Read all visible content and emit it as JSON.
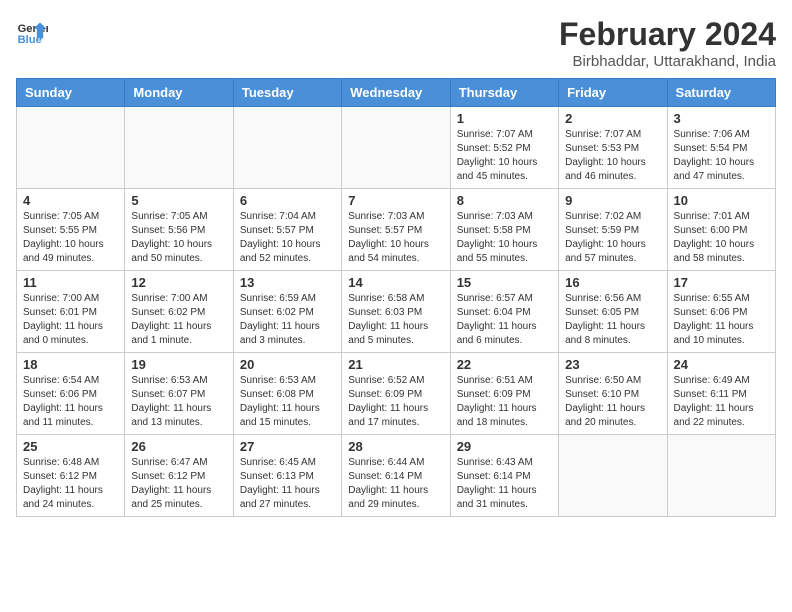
{
  "logo": {
    "text_general": "General",
    "text_blue": "Blue"
  },
  "header": {
    "title": "February 2024",
    "subtitle": "Birbhaddar, Uttarakhand, India"
  },
  "weekdays": [
    "Sunday",
    "Monday",
    "Tuesday",
    "Wednesday",
    "Thursday",
    "Friday",
    "Saturday"
  ],
  "weeks": [
    [
      {
        "day": "",
        "sunrise": "",
        "sunset": "",
        "daylight": ""
      },
      {
        "day": "",
        "sunrise": "",
        "sunset": "",
        "daylight": ""
      },
      {
        "day": "",
        "sunrise": "",
        "sunset": "",
        "daylight": ""
      },
      {
        "day": "",
        "sunrise": "",
        "sunset": "",
        "daylight": ""
      },
      {
        "day": "1",
        "sunrise": "Sunrise: 7:07 AM",
        "sunset": "Sunset: 5:52 PM",
        "daylight": "Daylight: 10 hours and 45 minutes."
      },
      {
        "day": "2",
        "sunrise": "Sunrise: 7:07 AM",
        "sunset": "Sunset: 5:53 PM",
        "daylight": "Daylight: 10 hours and 46 minutes."
      },
      {
        "day": "3",
        "sunrise": "Sunrise: 7:06 AM",
        "sunset": "Sunset: 5:54 PM",
        "daylight": "Daylight: 10 hours and 47 minutes."
      }
    ],
    [
      {
        "day": "4",
        "sunrise": "Sunrise: 7:05 AM",
        "sunset": "Sunset: 5:55 PM",
        "daylight": "Daylight: 10 hours and 49 minutes."
      },
      {
        "day": "5",
        "sunrise": "Sunrise: 7:05 AM",
        "sunset": "Sunset: 5:56 PM",
        "daylight": "Daylight: 10 hours and 50 minutes."
      },
      {
        "day": "6",
        "sunrise": "Sunrise: 7:04 AM",
        "sunset": "Sunset: 5:57 PM",
        "daylight": "Daylight: 10 hours and 52 minutes."
      },
      {
        "day": "7",
        "sunrise": "Sunrise: 7:03 AM",
        "sunset": "Sunset: 5:57 PM",
        "daylight": "Daylight: 10 hours and 54 minutes."
      },
      {
        "day": "8",
        "sunrise": "Sunrise: 7:03 AM",
        "sunset": "Sunset: 5:58 PM",
        "daylight": "Daylight: 10 hours and 55 minutes."
      },
      {
        "day": "9",
        "sunrise": "Sunrise: 7:02 AM",
        "sunset": "Sunset: 5:59 PM",
        "daylight": "Daylight: 10 hours and 57 minutes."
      },
      {
        "day": "10",
        "sunrise": "Sunrise: 7:01 AM",
        "sunset": "Sunset: 6:00 PM",
        "daylight": "Daylight: 10 hours and 58 minutes."
      }
    ],
    [
      {
        "day": "11",
        "sunrise": "Sunrise: 7:00 AM",
        "sunset": "Sunset: 6:01 PM",
        "daylight": "Daylight: 11 hours and 0 minutes."
      },
      {
        "day": "12",
        "sunrise": "Sunrise: 7:00 AM",
        "sunset": "Sunset: 6:02 PM",
        "daylight": "Daylight: 11 hours and 1 minute."
      },
      {
        "day": "13",
        "sunrise": "Sunrise: 6:59 AM",
        "sunset": "Sunset: 6:02 PM",
        "daylight": "Daylight: 11 hours and 3 minutes."
      },
      {
        "day": "14",
        "sunrise": "Sunrise: 6:58 AM",
        "sunset": "Sunset: 6:03 PM",
        "daylight": "Daylight: 11 hours and 5 minutes."
      },
      {
        "day": "15",
        "sunrise": "Sunrise: 6:57 AM",
        "sunset": "Sunset: 6:04 PM",
        "daylight": "Daylight: 11 hours and 6 minutes."
      },
      {
        "day": "16",
        "sunrise": "Sunrise: 6:56 AM",
        "sunset": "Sunset: 6:05 PM",
        "daylight": "Daylight: 11 hours and 8 minutes."
      },
      {
        "day": "17",
        "sunrise": "Sunrise: 6:55 AM",
        "sunset": "Sunset: 6:06 PM",
        "daylight": "Daylight: 11 hours and 10 minutes."
      }
    ],
    [
      {
        "day": "18",
        "sunrise": "Sunrise: 6:54 AM",
        "sunset": "Sunset: 6:06 PM",
        "daylight": "Daylight: 11 hours and 11 minutes."
      },
      {
        "day": "19",
        "sunrise": "Sunrise: 6:53 AM",
        "sunset": "Sunset: 6:07 PM",
        "daylight": "Daylight: 11 hours and 13 minutes."
      },
      {
        "day": "20",
        "sunrise": "Sunrise: 6:53 AM",
        "sunset": "Sunset: 6:08 PM",
        "daylight": "Daylight: 11 hours and 15 minutes."
      },
      {
        "day": "21",
        "sunrise": "Sunrise: 6:52 AM",
        "sunset": "Sunset: 6:09 PM",
        "daylight": "Daylight: 11 hours and 17 minutes."
      },
      {
        "day": "22",
        "sunrise": "Sunrise: 6:51 AM",
        "sunset": "Sunset: 6:09 PM",
        "daylight": "Daylight: 11 hours and 18 minutes."
      },
      {
        "day": "23",
        "sunrise": "Sunrise: 6:50 AM",
        "sunset": "Sunset: 6:10 PM",
        "daylight": "Daylight: 11 hours and 20 minutes."
      },
      {
        "day": "24",
        "sunrise": "Sunrise: 6:49 AM",
        "sunset": "Sunset: 6:11 PM",
        "daylight": "Daylight: 11 hours and 22 minutes."
      }
    ],
    [
      {
        "day": "25",
        "sunrise": "Sunrise: 6:48 AM",
        "sunset": "Sunset: 6:12 PM",
        "daylight": "Daylight: 11 hours and 24 minutes."
      },
      {
        "day": "26",
        "sunrise": "Sunrise: 6:47 AM",
        "sunset": "Sunset: 6:12 PM",
        "daylight": "Daylight: 11 hours and 25 minutes."
      },
      {
        "day": "27",
        "sunrise": "Sunrise: 6:45 AM",
        "sunset": "Sunset: 6:13 PM",
        "daylight": "Daylight: 11 hours and 27 minutes."
      },
      {
        "day": "28",
        "sunrise": "Sunrise: 6:44 AM",
        "sunset": "Sunset: 6:14 PM",
        "daylight": "Daylight: 11 hours and 29 minutes."
      },
      {
        "day": "29",
        "sunrise": "Sunrise: 6:43 AM",
        "sunset": "Sunset: 6:14 PM",
        "daylight": "Daylight: 11 hours and 31 minutes."
      },
      {
        "day": "",
        "sunrise": "",
        "sunset": "",
        "daylight": ""
      },
      {
        "day": "",
        "sunrise": "",
        "sunset": "",
        "daylight": ""
      }
    ]
  ]
}
